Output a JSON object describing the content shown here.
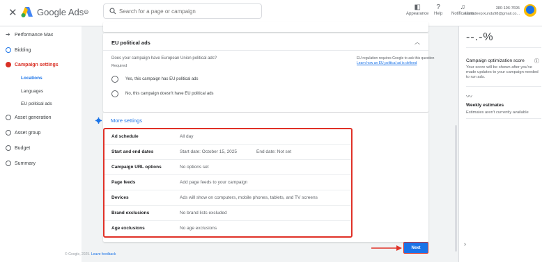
{
  "header": {
    "close_icon": "close-icon",
    "brand": "Google Ads",
    "search_placeholder": "Search for a page or campaign",
    "icons": [
      {
        "name": "appearance-icon",
        "label": "Appearance"
      },
      {
        "name": "help-icon",
        "label": "Help"
      },
      {
        "name": "notifications-icon",
        "label": "Notifications"
      }
    ],
    "account_phone": "380-196-7695",
    "account_email": "souradeep.kundu98@gmail.co..."
  },
  "sidebar": {
    "items": [
      {
        "label": "Performance Max",
        "state": "arrow"
      },
      {
        "label": "Bidding",
        "state": "done"
      },
      {
        "label": "Campaign settings",
        "state": "error"
      },
      {
        "label": "Asset generation",
        "state": "pending"
      },
      {
        "label": "Asset group",
        "state": "pending"
      },
      {
        "label": "Budget",
        "state": "pending"
      },
      {
        "label": "Summary",
        "state": "pending"
      }
    ],
    "subitems": [
      {
        "label": "Locations",
        "active": true
      },
      {
        "label": "Languages",
        "active": false
      },
      {
        "label": "EU political ads",
        "active": false
      }
    ]
  },
  "eu_section": {
    "title": "EU political ads",
    "question": "Does your campaign have European Union political ads?",
    "required": "Required",
    "options": [
      "Yes, this campaign has EU political ads",
      "No, this campaign doesn't have EU political ads"
    ],
    "note": "EU regulation requires Google to ask this question",
    "note_link": "Learn how an EU political ad is defined"
  },
  "more_settings": {
    "label": "More settings",
    "rows": [
      {
        "key": "Ad schedule",
        "value": "All day",
        "value2": ""
      },
      {
        "key": "Start and end dates",
        "value": "Start date: October 15, 2025",
        "value2": "End date: Not set"
      },
      {
        "key": "Campaign URL options",
        "value": "No options set",
        "value2": ""
      },
      {
        "key": "Page feeds",
        "value": "Add page feeds to your campaign",
        "value2": ""
      },
      {
        "key": "Devices",
        "value": "Ads will show on computers, mobile phones, tablets, and TV screens",
        "value2": ""
      },
      {
        "key": "Brand exclusions",
        "value": "No brand lists excluded",
        "value2": ""
      },
      {
        "key": "Age exclusions",
        "value": "No age exclusions",
        "value2": ""
      }
    ]
  },
  "actions": {
    "next_label": "Next"
  },
  "footer": {
    "copyright": "© Google, 2025.",
    "feedback": "Leave feedback"
  },
  "right_panel": {
    "score": "--.-%",
    "score_title": "Campaign optimization score",
    "score_desc": "Your score will be shown after you've made updates to your campaign needed to run ads.",
    "weekly_title": "Weekly estimates",
    "weekly_desc": "Estimates aren't currently available"
  },
  "colors": {
    "accent": "#1a73e8",
    "highlight": "#e03127",
    "error": "#d93025"
  }
}
